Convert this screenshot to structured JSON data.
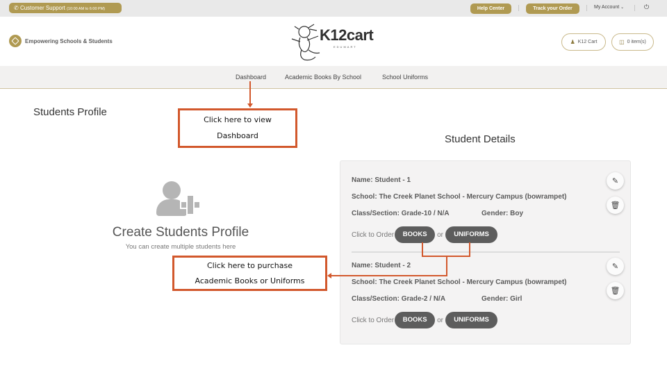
{
  "topbar": {
    "support_label": "Customer Support",
    "support_hours": "(10:00 AM to 6:00 PM)",
    "help_center": "Help Center",
    "track_order": "Track your Order",
    "my_account": "My Account",
    "phone_icon": "phone-icon",
    "power_icon": "power-icon"
  },
  "header": {
    "tagline": "Empowering Schools & Students",
    "logo_text": "K12cart",
    "logo_sub": "EDUMART",
    "account_button": "K12 Cart",
    "cart_button": "0 item(s)"
  },
  "nav": {
    "items": [
      {
        "label": "Dashboard"
      },
      {
        "label": "Academic Books By School"
      },
      {
        "label": "School Uniforms"
      }
    ]
  },
  "left": {
    "title": "Students Profile",
    "create_title": "Create Students Profile",
    "create_subtitle": "You can create multiple students here"
  },
  "callouts": {
    "dashboard": [
      "Click here to view",
      "Dashboard"
    ],
    "purchase": [
      "Click here to purchase",
      "Academic Books or Uniforms"
    ]
  },
  "right": {
    "title": "Student Details",
    "order_prefix": "Click to Order",
    "or_text": "or",
    "books_label": "BOOKS",
    "uniforms_label": "UNIFORMS",
    "students": [
      {
        "name": "Name: Student - 1",
        "school": "School: The Creek Planet School - Mercury Campus (bowrampet)",
        "class": "Class/Section: Grade-10 / N/A",
        "gender": "Gender: Boy"
      },
      {
        "name": "Name: Student - 2",
        "school": "School: The Creek Planet School - Mercury Campus (bowrampet)",
        "class": "Class/Section: Grade-2 / N/A",
        "gender": "Gender: Girl"
      }
    ]
  },
  "colors": {
    "gold": "#b09a52",
    "callout_orange": "#d2582c",
    "order_button": "#5d5d5d"
  }
}
